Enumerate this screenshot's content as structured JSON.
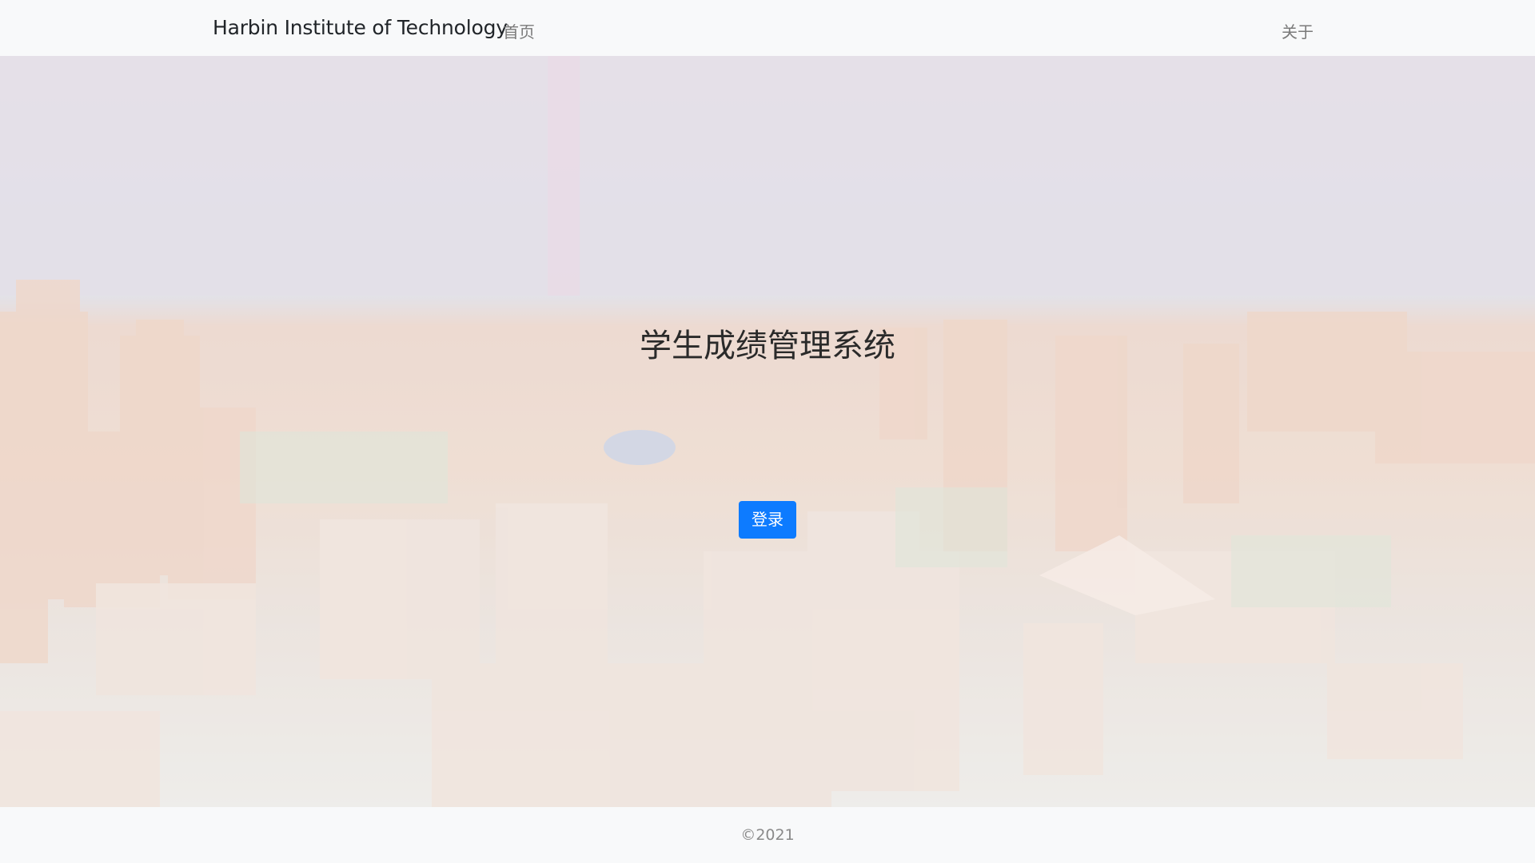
{
  "navbar": {
    "brand": "Harbin Institute of Technology",
    "home_label": "首页",
    "about_label": "关于"
  },
  "hero": {
    "title": "学生成绩管理系统",
    "login_label": "登录"
  },
  "footer": {
    "copyright": "©2021"
  },
  "colors": {
    "primary_button": "#0d7bff",
    "navbar_bg": "#f8f9fa"
  }
}
